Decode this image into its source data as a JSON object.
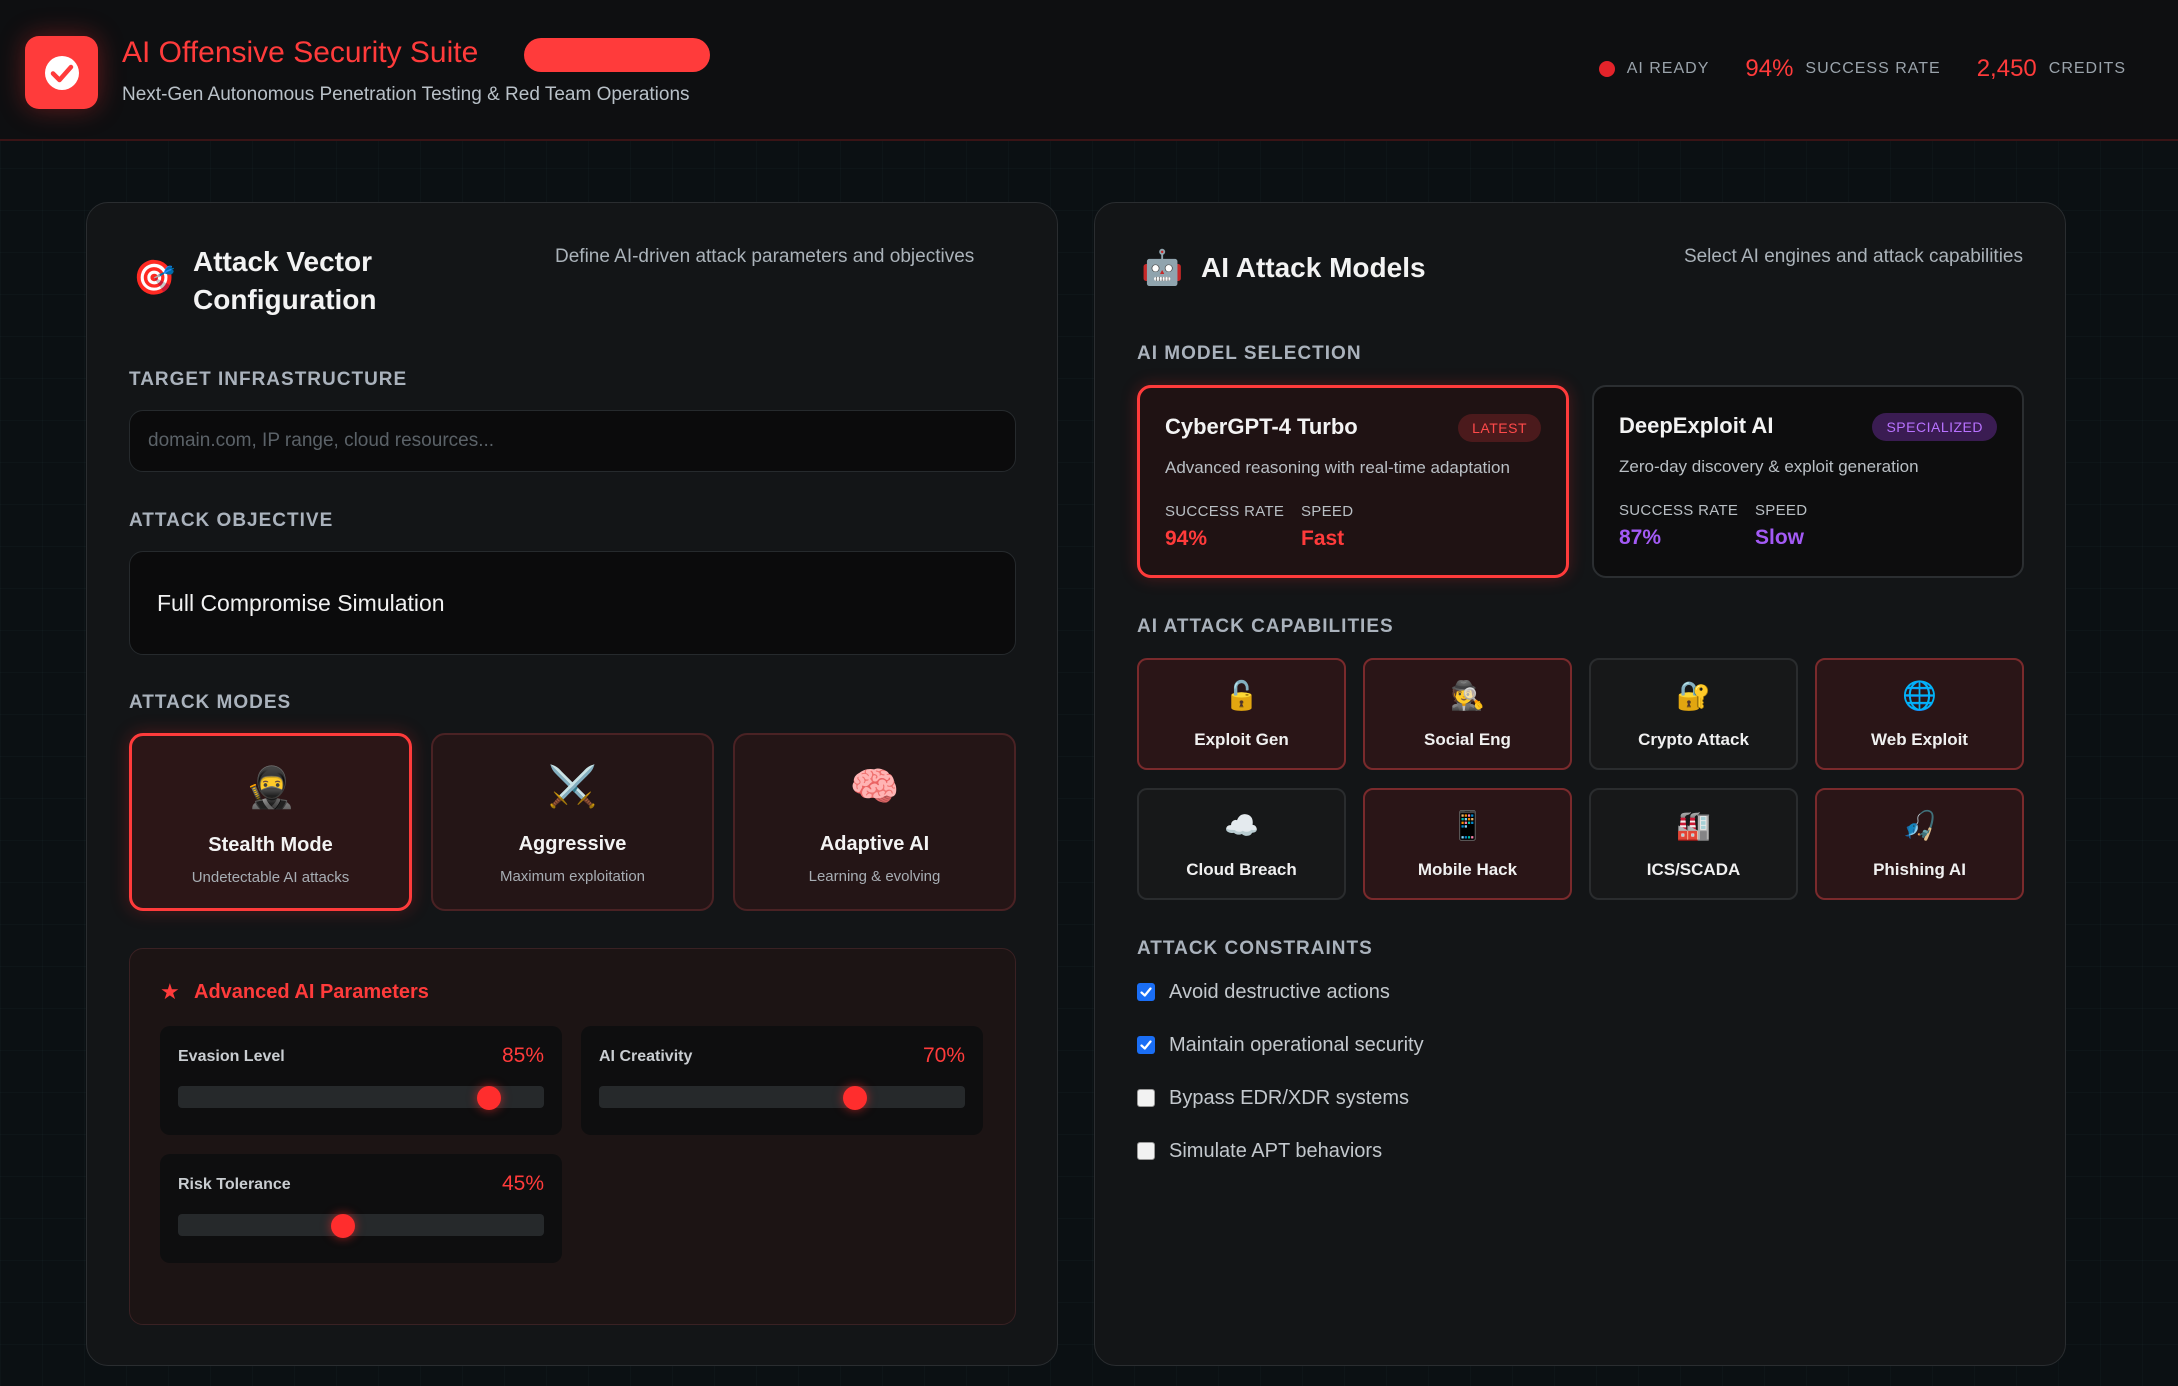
{
  "header": {
    "title": "AI Offensive Security Suite",
    "subtitle": "Next-Gen Autonomous Penetration Testing & Red Team Operations",
    "status_label": "AI READY",
    "success_rate_value": "94%",
    "success_rate_label": "SUCCESS RATE",
    "credits_value": "2,450",
    "credits_label": "CREDITS"
  },
  "left_panel": {
    "title": "Attack Vector Configuration",
    "title_line1": "Attack Vector",
    "title_line2": "Configuration",
    "description": "Define AI-driven attack parameters and objectives",
    "target_label": "TARGET INFRASTRUCTURE",
    "target_value": "",
    "target_placeholder": "domain.com, IP range, cloud resources...",
    "objective_label": "ATTACK OBJECTIVE",
    "objective_value": "Full Compromise Simulation",
    "modes_label": "ATTACK MODES",
    "modes": [
      {
        "name": "Stealth Mode",
        "desc": "Undetectable AI attacks",
        "icon": "🥷",
        "active": true
      },
      {
        "name": "Aggressive",
        "desc": "Maximum exploitation",
        "icon": "⚔️",
        "active": false
      },
      {
        "name": "Adaptive AI",
        "desc": "Learning & evolving",
        "icon": "🧠",
        "active": false
      }
    ],
    "advanced": {
      "title": "Advanced AI Parameters",
      "sliders": [
        {
          "label": "Evasion Level",
          "display": "85%",
          "value": 0.85
        },
        {
          "label": "AI Creativity",
          "display": "70%",
          "value": 0.7
        },
        {
          "label": "Risk Tolerance",
          "display": "45%",
          "value": 0.45
        }
      ]
    }
  },
  "right_panel": {
    "title": "AI Attack Models",
    "description": "Select AI engines and attack capabilities",
    "model_label": "AI MODEL SELECTION",
    "models": [
      {
        "name": "CyberGPT-4 Turbo",
        "badge": "LATEST",
        "desc": "Advanced reasoning with real-time adaptation",
        "rate_label": "SUCCESS RATE",
        "rate": "94%",
        "speed_label": "SPEED",
        "speed": "Fast",
        "active": true
      },
      {
        "name": "DeepExploit AI",
        "badge": "SPECIALIZED",
        "desc": "Zero-day discovery & exploit generation",
        "rate_label": "SUCCESS RATE",
        "rate": "87%",
        "speed_label": "SPEED",
        "speed": "Slow",
        "active": false
      }
    ],
    "capabilities_label": "AI ATTACK CAPABILITIES",
    "capabilities": [
      {
        "name": "Exploit Gen",
        "icon": "🔓",
        "selected": true
      },
      {
        "name": "Social Eng",
        "icon": "🕵️",
        "selected": true
      },
      {
        "name": "Crypto Attack",
        "icon": "🔐",
        "selected": false
      },
      {
        "name": "Web Exploit",
        "icon": "🌐",
        "selected": true
      },
      {
        "name": "Cloud Breach",
        "icon": "☁️",
        "selected": false
      },
      {
        "name": "Mobile Hack",
        "icon": "📱",
        "selected": true
      },
      {
        "name": "ICS/SCADA",
        "icon": "🏭",
        "selected": false
      },
      {
        "name": "Phishing AI",
        "icon": "🎣",
        "selected": true
      }
    ],
    "constraints_label": "ATTACK CONSTRAINTS",
    "constraints": [
      {
        "label": "Avoid destructive actions",
        "checked": true
      },
      {
        "label": "Maintain operational security",
        "checked": true
      },
      {
        "label": "Bypass EDR/XDR systems",
        "checked": false
      },
      {
        "label": "Simulate APT behaviors",
        "checked": false
      }
    ]
  },
  "colors": {
    "accent": "#ff3b3b",
    "purple": "#a35af5",
    "checkbox": "#1a6ef5"
  }
}
